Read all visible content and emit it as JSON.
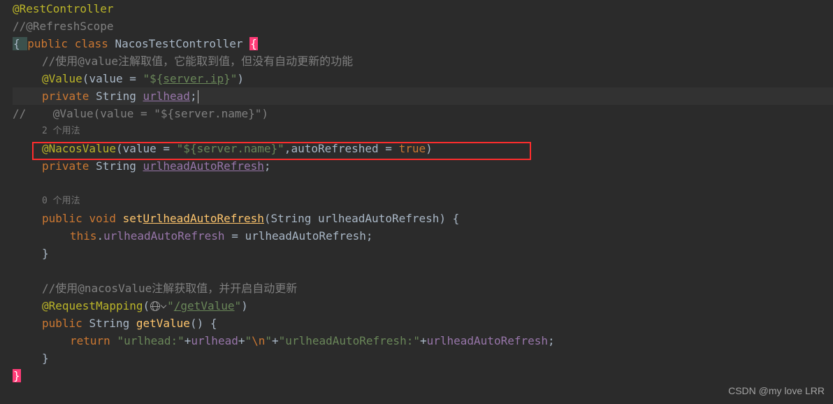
{
  "code": {
    "l1_ann": "@RestController",
    "l2_comment": "//@RefreshScope",
    "l3_open": "{ ",
    "l3_kw1": "public ",
    "l3_kw2": "class ",
    "l3_class": "NacosTestController ",
    "l3_brace": "{",
    "l4_comment": "//使用@value注解取值，它能取到值，但没有自动更新的功能",
    "l5_ann": "@Value",
    "l5_lp": "(",
    "l5_value_kw": "value = ",
    "l5_str_a": "\"${",
    "l5_str_link": "server.ip",
    "l5_str_b": "}\"",
    "l5_rp": ")",
    "l6_priv": "private ",
    "l6_type": "String ",
    "l6_name": "urlhead",
    "l6_semi": ";",
    "l7_pre": "//    ",
    "l7_rest": "@Value(value = \"${server.name}\")",
    "l8_hint": "2 个用法",
    "l9_ann": "@NacosValue",
    "l9_lp": "(",
    "l9_value_kw": "value = ",
    "l9_str": "\"${server.name}\"",
    "l9_comma": ",",
    "l9_auto": "autoRefreshed = ",
    "l9_true": "true",
    "l9_rp": ")",
    "l10_priv": "private ",
    "l10_type": "String ",
    "l10_name": "urlheadAutoRefresh",
    "l10_semi": ";",
    "l12_hint": "0 个用法",
    "l13_pub": "public ",
    "l13_void": "void ",
    "l13_fn": "set",
    "l13_fn_u": "UrlheadAutoRefresh",
    "l13_lp": "(",
    "l13_ptype": "String ",
    "l13_pname": "urlheadAutoRefresh",
    "l13_rp": ") ",
    "l13_ob": "{",
    "l14_this": "this",
    "l14_dot": ".",
    "l14_field": "urlheadAutoRefresh",
    "l14_eq": " = ",
    "l14_param": "urlheadAutoRefresh",
    "l14_semi": ";",
    "l15_cb": "}",
    "l17_comment": "//使用@nacosValue注解获取值，并开启自动更新",
    "l18_ann": "@RequestMapping",
    "l18_lp": "(",
    "l18_str_q1": "\"",
    "l18_str_link": "/getValue",
    "l18_str_q2": "\"",
    "l18_rp": ")",
    "l19_pub": "public ",
    "l19_type": "String ",
    "l19_fn": "getValue",
    "l19_lp": "()",
    "l19_sp": " ",
    "l19_ob": "{",
    "l20_ret": "return ",
    "l20_s1": "\"urlhead:\"",
    "l20_p1": "+",
    "l20_v1": "urlhead",
    "l20_p2": "+",
    "l20_s2": "\"",
    "l20_esc": "\\n",
    "l20_s2b": "\"",
    "l20_p3": "+",
    "l20_s3": "\"urlheadAutoRefresh:\"",
    "l20_p4": "+",
    "l20_v2": "urlheadAutoRefresh",
    "l20_semi": ";",
    "l21_cb": "}",
    "l22_cb": "}"
  },
  "watermark": "CSDN @my love  LRR"
}
